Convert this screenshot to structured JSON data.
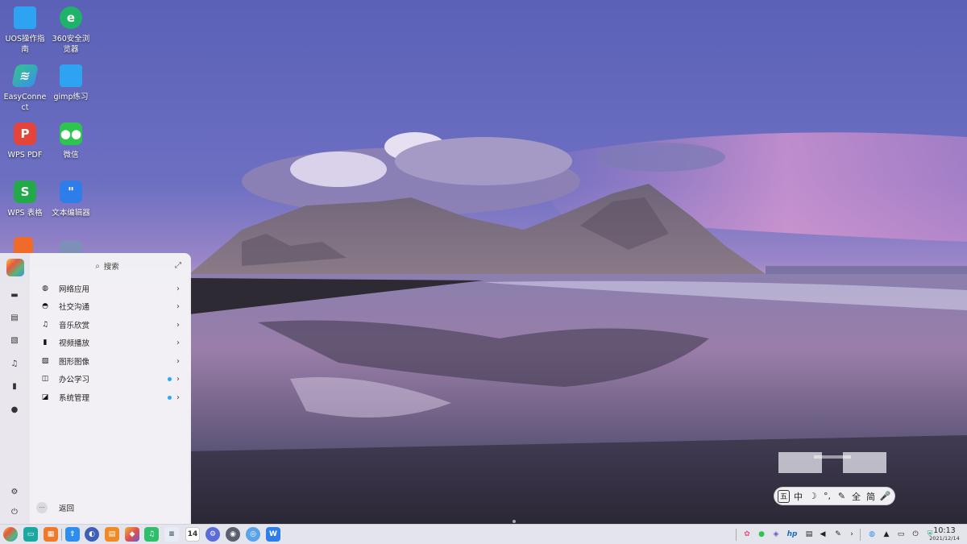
{
  "desktop": {
    "icons": [
      {
        "label": "UOS操作指南",
        "icon": "folder-icon"
      },
      {
        "label": "360安全浏览器",
        "icon": "browser-360-icon"
      },
      {
        "label": "EasyConnect",
        "icon": "easyconnect-icon"
      },
      {
        "label": "gimp练习",
        "icon": "folder-icon"
      },
      {
        "label": "WPS PDF",
        "icon": "wps-pdf-icon"
      },
      {
        "label": "微信",
        "icon": "wechat-icon"
      },
      {
        "label": "WPS 表格",
        "icon": "wps-sheet-icon"
      },
      {
        "label": "文本编辑器",
        "icon": "text-editor-icon"
      }
    ]
  },
  "launcher": {
    "search_placeholder": "搜索",
    "categories": [
      {
        "label": "网络应用",
        "icon": "globe-icon",
        "dot": false
      },
      {
        "label": "社交沟通",
        "icon": "chat-bubble-icon",
        "dot": false
      },
      {
        "label": "音乐欣赏",
        "icon": "music-note-icon",
        "dot": false
      },
      {
        "label": "视频播放",
        "icon": "film-icon",
        "dot": false
      },
      {
        "label": "图形图像",
        "icon": "image-icon",
        "dot": false
      },
      {
        "label": "办公学习",
        "icon": "office-icon",
        "dot": true
      },
      {
        "label": "系统管理",
        "icon": "system-icon",
        "dot": true
      }
    ],
    "back_label": "返回",
    "back_icon_text": "···"
  },
  "ime": {
    "buttons": [
      "五",
      "中",
      "☽",
      "°,",
      "✎",
      "全",
      "简",
      "🎤"
    ]
  },
  "taskbar": {
    "time": "10:13",
    "date": "2021/12/14"
  },
  "colors": {
    "accent_dot": "#2ca7f8",
    "taskbar_bg": "#e8e8ee"
  }
}
